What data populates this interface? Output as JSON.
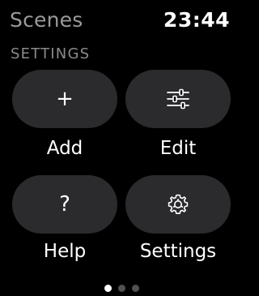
{
  "header": {
    "app_title": "Scenes",
    "time": "23:44"
  },
  "section": {
    "title": "SETTINGS"
  },
  "actions": [
    {
      "label": "Add",
      "icon": "plus-icon",
      "glyph": "+"
    },
    {
      "label": "Edit",
      "icon": "sliders-icon"
    },
    {
      "label": "Help",
      "icon": "question-icon",
      "glyph": "?"
    },
    {
      "label": "Settings",
      "icon": "gear-icon"
    }
  ],
  "pagination": {
    "page_count": 3,
    "current_page": 1
  },
  "colors": {
    "background": "#000000",
    "tile": "#2b2b2d",
    "title_gray": "#9a9a9a"
  }
}
